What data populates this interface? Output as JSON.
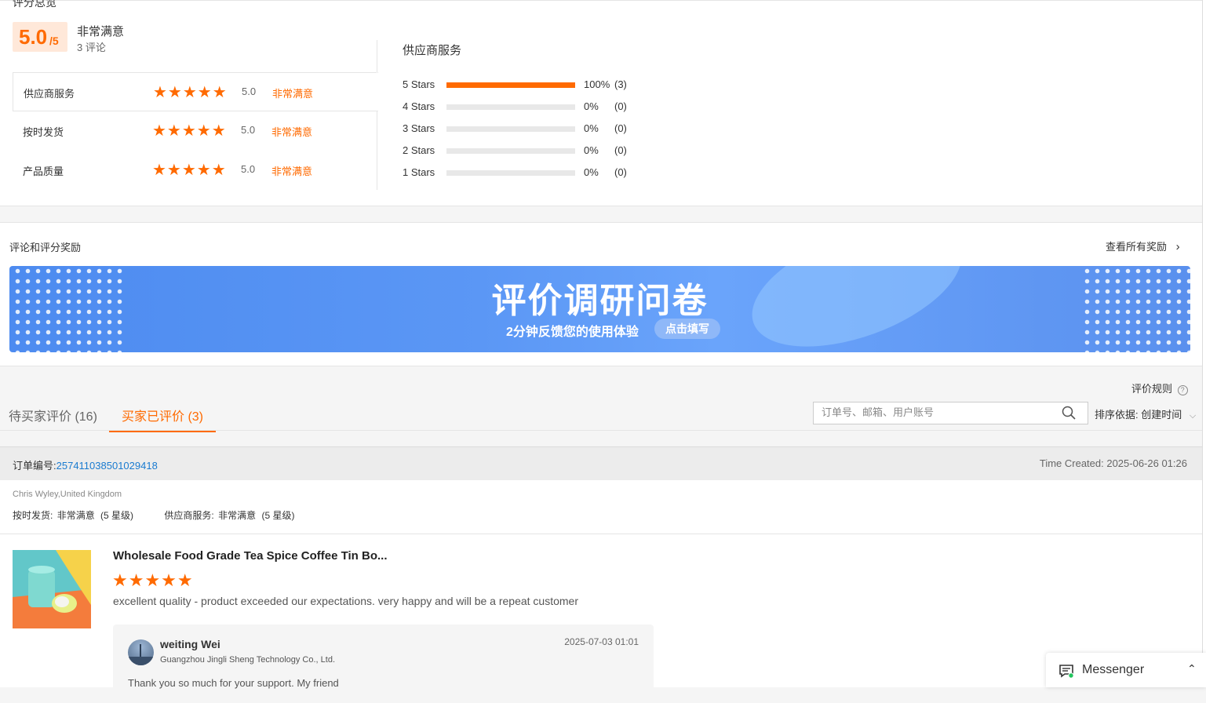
{
  "overview": {
    "title": "评分总览",
    "score": "5.0",
    "score_suffix": "/5",
    "overall_label": "非常满意",
    "review_count": "3 评论",
    "ratings": [
      {
        "label": "供应商服务",
        "stars": "★★★★★",
        "value": "5.0",
        "text": "非常满意"
      },
      {
        "label": "按时发货",
        "stars": "★★★★★",
        "value": "5.0",
        "text": "非常满意"
      },
      {
        "label": "产品质量",
        "stars": "★★★★★",
        "value": "5.0",
        "text": "非常满意"
      }
    ],
    "distribution_title": "供应商服务",
    "distribution": [
      {
        "label": "5 Stars",
        "fraction": 1.0,
        "percent": "100%",
        "count": "(3)"
      },
      {
        "label": "4 Stars",
        "fraction": 0,
        "percent": "0%",
        "count": "(0)"
      },
      {
        "label": "3 Stars",
        "fraction": 0,
        "percent": "0%",
        "count": "(0)"
      },
      {
        "label": "2 Stars",
        "fraction": 0,
        "percent": "0%",
        "count": "(0)"
      },
      {
        "label": "1 Stars",
        "fraction": 0,
        "percent": "0%",
        "count": "(0)"
      }
    ]
  },
  "rewards": {
    "title": "评论和评分奖励",
    "link": "查看所有奖励",
    "banner_title": "评价调研问卷",
    "banner_subtitle": "2分钟反馈您的使用体验",
    "banner_button": "点击填写"
  },
  "reviews": {
    "rules_link": "评价规则",
    "tabs": [
      {
        "label": "待买家评价 (16)",
        "active": false
      },
      {
        "label": "买家已评价 (3)",
        "active": true
      }
    ],
    "search_placeholder": "订单号、邮箱、用户账号",
    "sort_label": "排序依据: 创建时间"
  },
  "order": {
    "number_label": "订单编号:",
    "number": "257411038501029418",
    "time_created": "Time Created: 2025-06-26 01:26",
    "buyer": "Chris Wyley,United Kingdom",
    "buyer_rating_1_label": "按时发货:",
    "buyer_rating_1_value": "非常满意",
    "buyer_rating_1_stars": "(5 星级)",
    "buyer_rating_2_label": "供应商服务:",
    "buyer_rating_2_value": "非常满意",
    "buyer_rating_2_stars": "(5 星级)",
    "product_title": "Wholesale Food Grade Tea Spice Coffee Tin Bo...",
    "product_stars": "★★★★★",
    "comment": "excellent quality - product exceeded our expectations. very happy and will be a repeat customer",
    "reply": {
      "name": "weiting Wei",
      "company": "Guangzhou Jingli Sheng Technology Co., Ltd.",
      "date": "2025-07-03 01:01",
      "text": "Thank you so much for your support. My friend"
    }
  },
  "messenger": {
    "label": "Messenger"
  },
  "colors": {
    "accent": "#ff6a00",
    "link": "#1a7bd0",
    "banner": "#5b97f5"
  }
}
